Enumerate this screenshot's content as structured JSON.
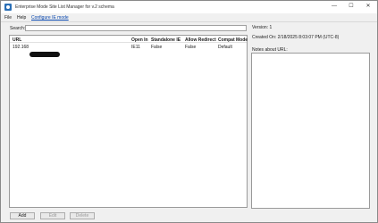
{
  "window": {
    "title": "Enterprise Mode Site List Manager for v.2 schema",
    "minimize": "—",
    "maximize": "☐",
    "close": "✕"
  },
  "menu": {
    "file": "File",
    "help": "Help",
    "configure": "Configure IE mode"
  },
  "search": {
    "label": "Search:",
    "value": ""
  },
  "table": {
    "headers": [
      "URL",
      "Open In",
      "Standalone IE",
      "Allow Redirect",
      "Compat Mode"
    ],
    "rows": [
      [
        "192.168",
        "IE11",
        "False",
        "False",
        "Default"
      ]
    ]
  },
  "info": {
    "version": "Version: 1",
    "created": "Created On: 2/18/2025 8:03:07 PM (UTC-8)",
    "notes_label": "Notes about URL:",
    "notes_value": ""
  },
  "buttons": {
    "add": "Add",
    "edit": "Edit",
    "delete": "Delete"
  }
}
